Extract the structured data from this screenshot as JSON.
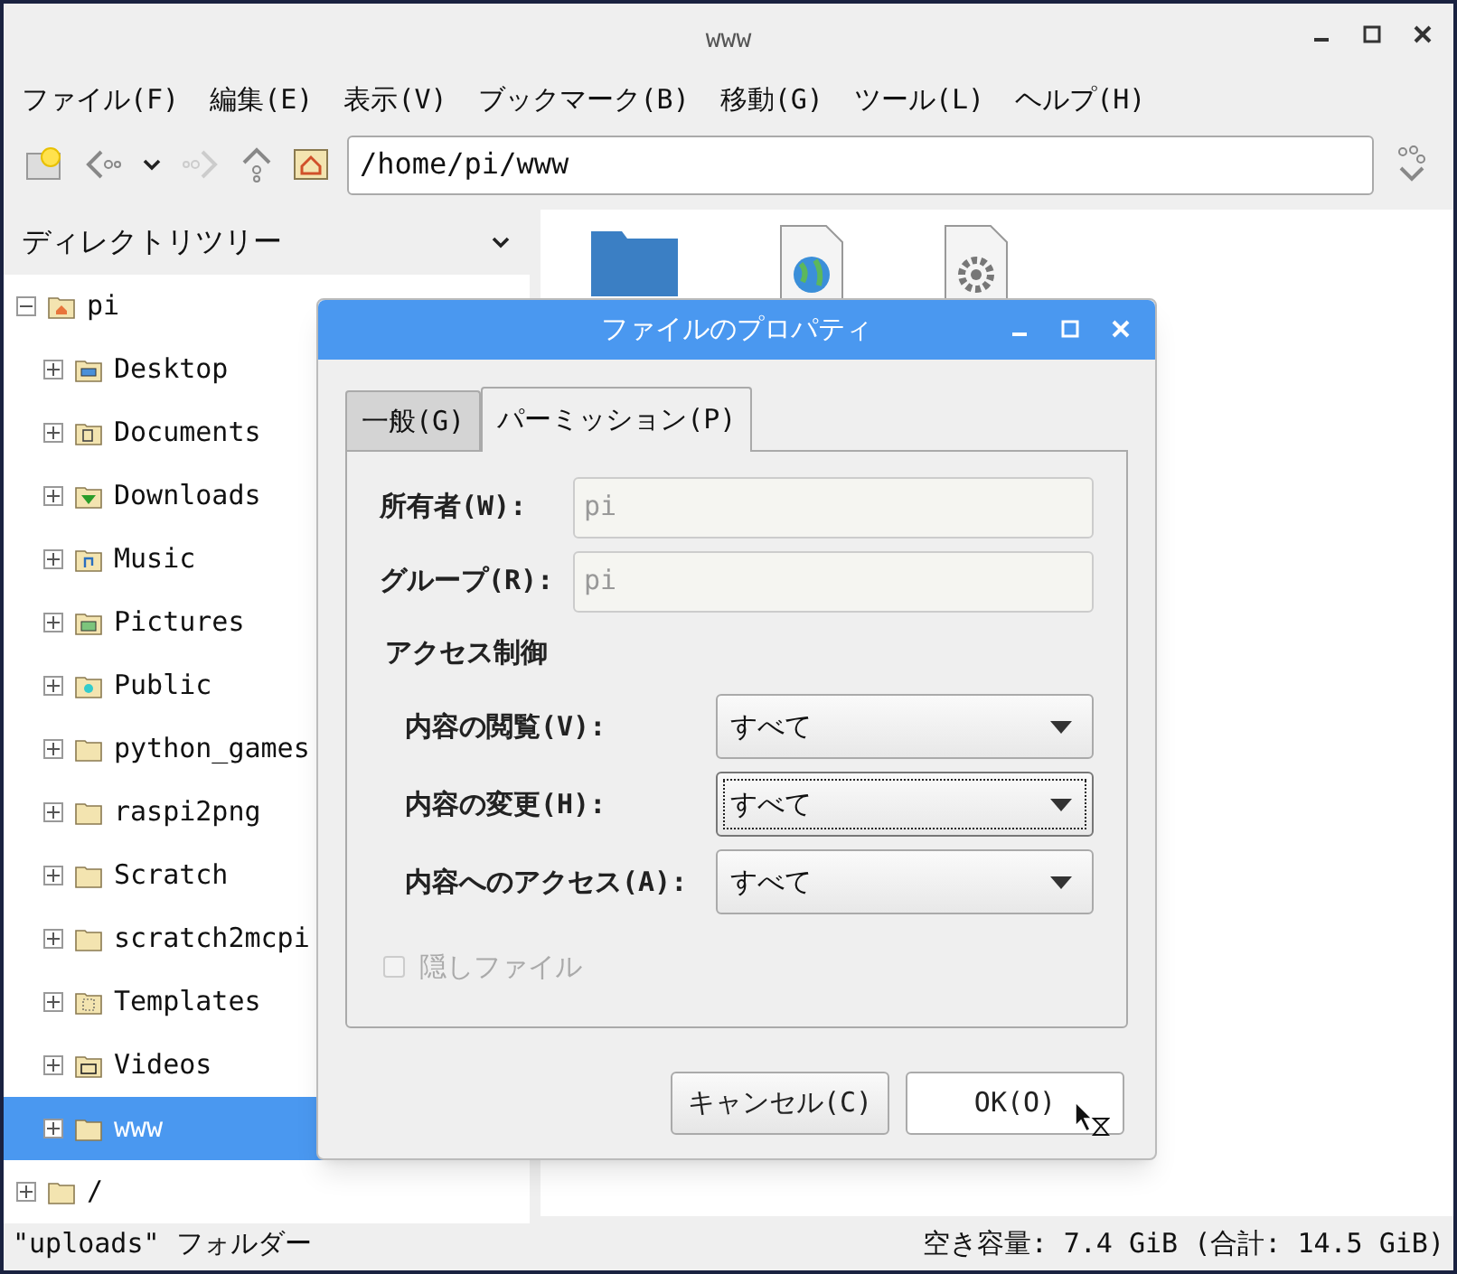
{
  "window": {
    "title": "www"
  },
  "menu": [
    "ファイル(F)",
    "編集(E)",
    "表示(V)",
    "ブックマーク(B)",
    "移動(G)",
    "ツール(L)",
    "ヘルプ(H)"
  ],
  "toolbar": {
    "path": "/home/pi/www"
  },
  "sidebar": {
    "title": "ディレクトリツリー",
    "tree": [
      {
        "label": "pi",
        "kind": "home",
        "expanded": true,
        "selected": false,
        "children": [
          {
            "label": "Desktop",
            "kind": "desktop",
            "expanded": false,
            "selected": false
          },
          {
            "label": "Documents",
            "kind": "documents",
            "expanded": false,
            "selected": false
          },
          {
            "label": "Downloads",
            "kind": "downloads",
            "expanded": false,
            "selected": false
          },
          {
            "label": "Music",
            "kind": "music",
            "expanded": false,
            "selected": false
          },
          {
            "label": "Pictures",
            "kind": "pictures",
            "expanded": false,
            "selected": false
          },
          {
            "label": "Public",
            "kind": "public",
            "expanded": false,
            "selected": false
          },
          {
            "label": "python_games",
            "kind": "folder",
            "expanded": false,
            "selected": false
          },
          {
            "label": "raspi2png",
            "kind": "folder",
            "expanded": false,
            "selected": false
          },
          {
            "label": "Scratch",
            "kind": "folder",
            "expanded": false,
            "selected": false
          },
          {
            "label": "scratch2mcpi",
            "kind": "folder",
            "expanded": false,
            "selected": false
          },
          {
            "label": "Templates",
            "kind": "templates",
            "expanded": false,
            "selected": false
          },
          {
            "label": "Videos",
            "kind": "videos",
            "expanded": false,
            "selected": false
          },
          {
            "label": "www",
            "kind": "folder",
            "expanded": false,
            "selected": true
          }
        ]
      },
      {
        "label": "/",
        "kind": "folder",
        "expanded": false,
        "selected": false
      }
    ]
  },
  "files": [
    {
      "kind": "folder"
    },
    {
      "kind": "web"
    },
    {
      "kind": "settings"
    }
  ],
  "dialog": {
    "title": "ファイルのプロパティ",
    "tabs": [
      {
        "label": "一般(G)",
        "selected": false
      },
      {
        "label": "パーミッション(P)",
        "selected": true
      }
    ],
    "fields": [
      {
        "label": "所有者(W):",
        "value": "pi",
        "disabled": true
      },
      {
        "label": "グループ(R):",
        "value": "pi",
        "disabled": true
      }
    ],
    "section": "アクセス制御",
    "selects": [
      {
        "label": "内容の閲覧(V):",
        "value": "すべて",
        "focused": false
      },
      {
        "label": "内容の変更(H):",
        "value": "すべて",
        "focused": true
      },
      {
        "label": "内容へのアクセス(A):",
        "value": "すべて",
        "focused": false
      }
    ],
    "checkbox": {
      "label": "隠しファイル",
      "checked": false,
      "disabled": true
    },
    "buttons": [
      "キャンセル(C)",
      "OK(O)"
    ]
  },
  "status_bar": {
    "left": "\"uploads\" フォルダー",
    "right": "空き容量: 7.4 GiB (合計: 14.5 GiB)"
  }
}
